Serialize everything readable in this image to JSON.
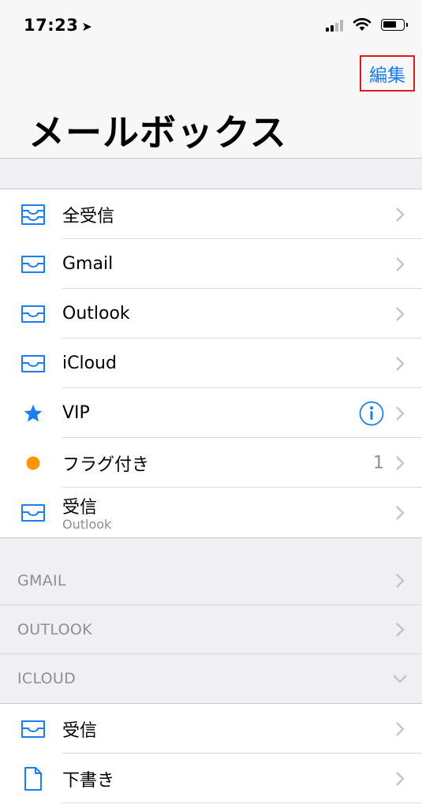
{
  "status_bar": {
    "time": "17:23"
  },
  "nav": {
    "edit_label": "編集",
    "title": "メールボックス"
  },
  "mailboxes": [
    {
      "label": "全受信",
      "icon": "tray-stack-icon"
    },
    {
      "label": "Gmail",
      "icon": "tray-icon"
    },
    {
      "label": "Outlook",
      "icon": "tray-icon"
    },
    {
      "label": "iCloud",
      "icon": "tray-icon"
    },
    {
      "label": "VIP",
      "icon": "star-icon"
    },
    {
      "label": "フラグ付き",
      "icon": "flag-dot-icon",
      "count": "1"
    },
    {
      "label": "受信",
      "sublabel": "Outlook",
      "icon": "tray-icon"
    }
  ],
  "accounts": [
    {
      "label": "GMAIL"
    },
    {
      "label": "OUTLOOK"
    },
    {
      "label": "ICLOUD"
    }
  ],
  "icloud_folders": [
    {
      "label": "受信",
      "icon": "tray-icon"
    },
    {
      "label": "下書き",
      "icon": "document-icon"
    }
  ],
  "colors": {
    "accent": "#1a7ef2",
    "flag": "#ff9500",
    "highlight": "#e0171b"
  }
}
